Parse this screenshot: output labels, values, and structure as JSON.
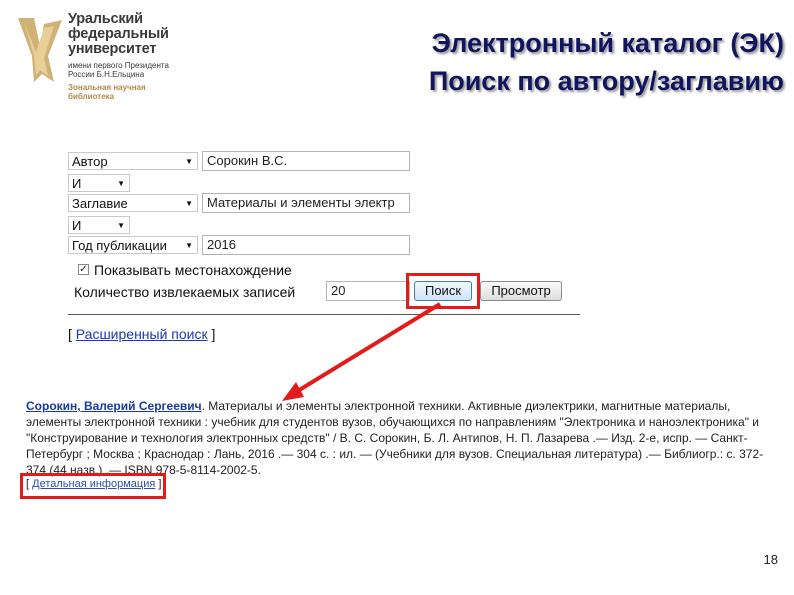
{
  "logo": {
    "name_line1": "Уральский",
    "name_line2": "федеральный",
    "name_line3": "университет",
    "subtitle": "имени первого Президента России Б.Н.Ельцина",
    "library": "Зональная научная библиотека"
  },
  "title": {
    "line1": "Электронный каталог (ЭК)",
    "line2": "Поиск по автору/заглавию"
  },
  "form": {
    "rows": [
      {
        "field": "Автор",
        "value": "Сорокин В.С."
      },
      {
        "op": "И"
      },
      {
        "field": "Заглавие",
        "value": "Материалы и элементы электр"
      },
      {
        "op": "И"
      },
      {
        "field": "Год публикации",
        "value": "2016"
      }
    ],
    "show_location_label": "Показывать местонахождение",
    "show_location_checked": true,
    "records_label": "Количество извлекаемых записей",
    "records_value": "20",
    "search_button": "Поиск",
    "browse_button": "Просмотр",
    "advanced_open": "[",
    "advanced_link": "Расширенный поиск",
    "advanced_close": "]"
  },
  "result": {
    "author": "Сорокин, Валерий Сергеевич",
    "text": ". Материалы и элементы электронной техники. Активные диэлектрики, магнитные материалы, элементы электронной техники : учебник для студентов вузов, обучающихся по направлениям \"Электроника и наноэлектроника\" и \"Конструирование и технология электронных средств\" / В. С. Сорокин, Б. Л. Антипов, Н. П. Лазарева .— Изд. 2-е, испр. — Санкт-Петербург ; Москва ; Краснодар : Лань, 2016 .— 304 с. : ил. — (Учебники для вузов. Специальная литература) .— Библиогр.: с. 372-374 (44 назв.) .— ISBN 978-5-8114-2002-5.",
    "detail_open": "[",
    "detail_link": "Детальная информация",
    "detail_close": "]"
  },
  "page_number": "18",
  "colors": {
    "title": "#10155e",
    "link": "#1f37b6",
    "highlight": "#e21b1b",
    "logo_gold": "#b28a48"
  }
}
